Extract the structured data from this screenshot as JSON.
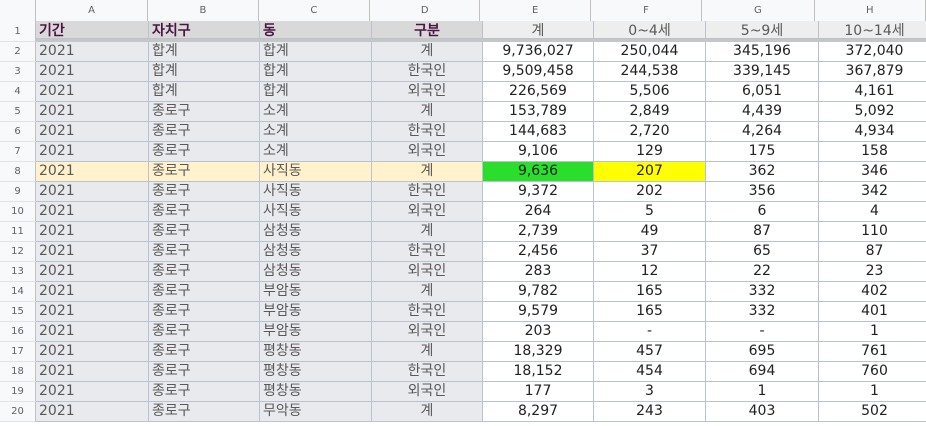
{
  "columns": [
    "A",
    "B",
    "C",
    "D",
    "E",
    "F",
    "G",
    "H"
  ],
  "header": [
    "기간",
    "자치구",
    "동",
    "구분",
    "계",
    "0~4세",
    "5~9세",
    "10~14세"
  ],
  "rows": [
    [
      "2021",
      "합계",
      "합계",
      "계",
      "9,736,027",
      "250,044",
      "345,196",
      "372,040"
    ],
    [
      "2021",
      "합계",
      "합계",
      "한국인",
      "9,509,458",
      "244,538",
      "339,145",
      "367,879"
    ],
    [
      "2021",
      "합계",
      "합계",
      "외국인",
      "226,569",
      "5,506",
      "6,051",
      "4,161"
    ],
    [
      "2021",
      "종로구",
      "소계",
      "계",
      "153,789",
      "2,849",
      "4,439",
      "5,092"
    ],
    [
      "2021",
      "종로구",
      "소계",
      "한국인",
      "144,683",
      "2,720",
      "4,264",
      "4,934"
    ],
    [
      "2021",
      "종로구",
      "소계",
      "외국인",
      "9,106",
      "129",
      "175",
      "158"
    ],
    [
      "2021",
      "종로구",
      "사직동",
      "계",
      "9,636",
      "207",
      "362",
      "346"
    ],
    [
      "2021",
      "종로구",
      "사직동",
      "한국인",
      "9,372",
      "202",
      "356",
      "342"
    ],
    [
      "2021",
      "종로구",
      "사직동",
      "외국인",
      "264",
      "5",
      "6",
      "4"
    ],
    [
      "2021",
      "종로구",
      "삼청동",
      "계",
      "2,739",
      "49",
      "87",
      "110"
    ],
    [
      "2021",
      "종로구",
      "삼청동",
      "한국인",
      "2,456",
      "37",
      "65",
      "87"
    ],
    [
      "2021",
      "종로구",
      "삼청동",
      "외국인",
      "283",
      "12",
      "22",
      "23"
    ],
    [
      "2021",
      "종로구",
      "부암동",
      "계",
      "9,782",
      "165",
      "332",
      "402"
    ],
    [
      "2021",
      "종로구",
      "부암동",
      "한국인",
      "9,579",
      "165",
      "332",
      "401"
    ],
    [
      "2021",
      "종로구",
      "부암동",
      "외국인",
      "203",
      "-",
      "-",
      "1"
    ],
    [
      "2021",
      "종로구",
      "평창동",
      "계",
      "18,329",
      "457",
      "695",
      "761"
    ],
    [
      "2021",
      "종로구",
      "평창동",
      "한국인",
      "18,152",
      "454",
      "694",
      "760"
    ],
    [
      "2021",
      "종로구",
      "평창동",
      "외국인",
      "177",
      "3",
      "1",
      "1"
    ],
    [
      "2021",
      "종로구",
      "무악동",
      "계",
      "8,297",
      "243",
      "403",
      "502"
    ]
  ],
  "row_numbers": [
    "1",
    "2",
    "3",
    "4",
    "5",
    "6",
    "7",
    "8",
    "9",
    "10",
    "11",
    "12",
    "13",
    "14",
    "15",
    "16",
    "17",
    "18",
    "19",
    "20"
  ],
  "highlight": {
    "row_index": 6,
    "green_col": 4,
    "yellow_col": 5,
    "row_color": "#fff2cc",
    "green": "#2bde2b",
    "yellow": "#ffff00"
  }
}
